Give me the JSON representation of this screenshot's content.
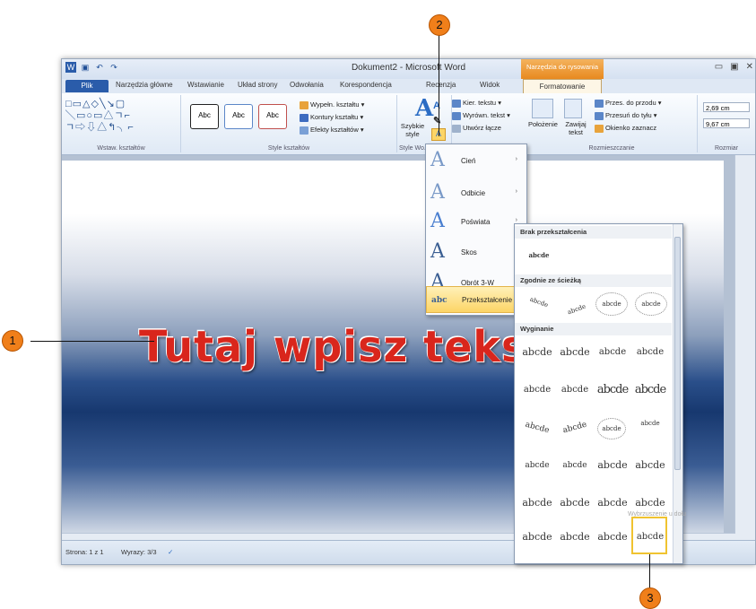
{
  "window": {
    "title": "Dokument2 - Microsoft Word",
    "context_tab_group": "Narzędzia do rysowania",
    "controls": [
      "▭",
      "▣",
      "✕"
    ]
  },
  "tabs": [
    "Plik",
    "Narzędzia główne",
    "Wstawianie",
    "Układ strony",
    "Odwołania",
    "Korespondencja",
    "Recenzja",
    "Widok",
    "Formatowanie"
  ],
  "ribbon": {
    "shapes_label": "Wstaw. kształtów",
    "style_samples": [
      "Abc",
      "Abc",
      "Abc"
    ],
    "fill": "Wypełn. kształtu",
    "outline": "Kontury kształtu",
    "effects": "Efekty kształtów",
    "shape_styles_label": "Style kształtów",
    "quick_styles": "Szybkie style",
    "wordart_label": "Style Wo...",
    "text_direction": "Kier. tekstu",
    "align_text": "Wyrówn. tekst",
    "create_link": "Utwórz łącze",
    "position": "Położenie",
    "wrap": "Zawijaj tekst",
    "bring_forward": "Przes. do przodu",
    "send_back": "Przesuń do tyłu",
    "selection_pane": "Okienko zaznacz",
    "arrange_label": "Rozmieszczanie",
    "height": "2,69 cm",
    "width": "9,67 cm",
    "size_label": "Rozmiar"
  },
  "document": {
    "wordart_text": "Tutaj wpisz tekst"
  },
  "status": {
    "page": "Strona: 1 z 1",
    "words": "Wyrazy: 3/3"
  },
  "effects_menu": [
    {
      "label": "Cień",
      "icon": "A"
    },
    {
      "label": "Odbicie",
      "icon": "A"
    },
    {
      "label": "Poświata",
      "icon": "A"
    },
    {
      "label": "Skos",
      "icon": "A"
    },
    {
      "label": "Obrót 3-W",
      "icon": "A"
    },
    {
      "label": "Przekształcenie",
      "icon": "abc"
    }
  ],
  "transform_gallery": {
    "no_transform_header": "Brak przekształcenia",
    "no_transform_sample": "abcde",
    "follow_path_header": "Zgodnie ze ścieżką",
    "warp_header": "Wyginanie",
    "sample": "abcde",
    "tooltip": "Wybrzuszenie u dołu"
  },
  "callouts": [
    "1",
    "2",
    "3"
  ]
}
